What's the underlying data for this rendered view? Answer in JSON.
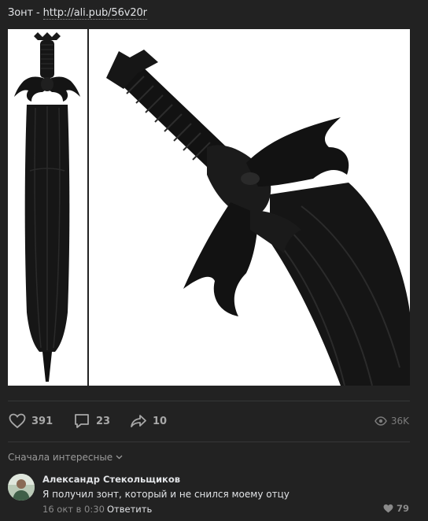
{
  "post": {
    "text_prefix": "Зонт - ",
    "link": "http://ali.pub/56v20r"
  },
  "actions": {
    "likes": "391",
    "comments": "23",
    "shares": "10",
    "views": "36K"
  },
  "comments_section": {
    "sort_label": "Сначала интересные"
  },
  "comment": {
    "author": "Александр Стекольщиков",
    "text": "Я получил зонт, который и не снился моему отцу",
    "date": "16 окт в 0:30",
    "reply_label": "Ответить",
    "likes": "79"
  }
}
